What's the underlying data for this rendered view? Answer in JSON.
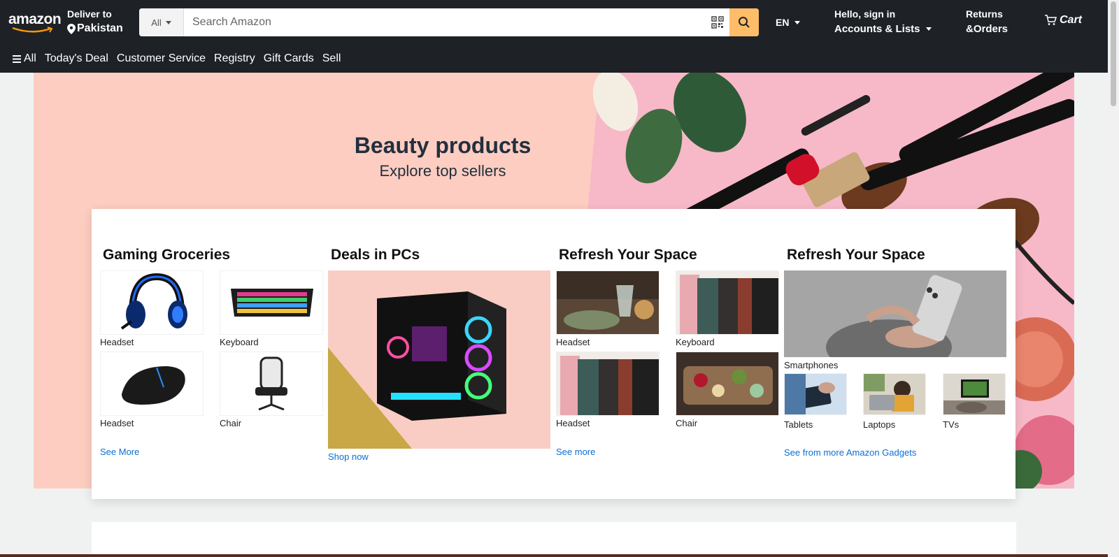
{
  "header": {
    "logo_text": "amazon",
    "deliver_line1": "Deliver to",
    "deliver_line2": "Pakistan",
    "search_category": "All",
    "search_placeholder": "Search Amazon",
    "lang": "EN",
    "account_line1": "Hello, sign in",
    "account_line2": "Accounts & Lists",
    "returns_line1": "Returns",
    "returns_line2": "&Orders",
    "cart_label": "Cart",
    "accent_color": "#febd69",
    "bg_color": "#1e2227"
  },
  "subnav": {
    "all_label": "All",
    "items": [
      "Today's Deal",
      "Customer Service",
      "Registry",
      "Gift Cards",
      "Sell"
    ]
  },
  "hero": {
    "title": "Beauty products",
    "subtitle": "Explore top sellers",
    "bg_color": "#fdcdc1"
  },
  "cards": [
    {
      "title": "Gaming Groceries",
      "tiles": [
        "Headset",
        "Keyboard",
        "Headset",
        "Chair"
      ],
      "link": "See More"
    },
    {
      "title": "Deals in PCs",
      "link": "Shop now"
    },
    {
      "title": "Refresh Your Space",
      "tiles": [
        "Headset",
        "Keyboard",
        "Headset",
        "Chair"
      ],
      "link": "See more"
    },
    {
      "title": "Refresh Your Space",
      "main_label": "Smartphones",
      "tiles": [
        "Tablets",
        "Laptops",
        "TVs"
      ],
      "link": "See from more Amazon Gadgets"
    }
  ]
}
